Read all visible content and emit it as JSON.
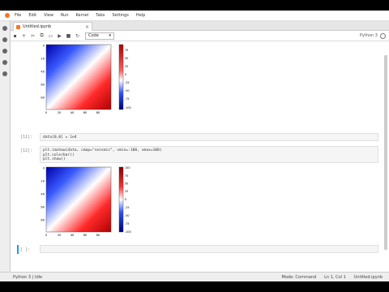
{
  "menu": [
    "File",
    "Edit",
    "View",
    "Run",
    "Kernel",
    "Tabs",
    "Settings",
    "Help"
  ],
  "tab": {
    "title": "Untitled.ipynb",
    "close": "×"
  },
  "toolbar": {
    "cell_type": "Code",
    "dropdown": "▾",
    "kernel": "Python 3"
  },
  "cells": [
    {
      "prompt": "[11]:",
      "lines": [
        "data[0,0] = 1e4"
      ]
    },
    {
      "prompt": "[12]:",
      "lines": [
        "plt.imshow(data, cmap=\"seismic\", vmin=-100, vmax=100)",
        "plt.colorbar()",
        "plt.show()"
      ]
    },
    {
      "prompt": "[ ]:",
      "lines": [
        ""
      ]
    }
  ],
  "plot1": {
    "y_ticks": [
      "0",
      "20",
      "40",
      "60",
      "80"
    ],
    "x_ticks": [
      "0",
      "20",
      "40",
      "60",
      "80"
    ],
    "cbar_ticks": [
      "75",
      "50",
      "25",
      "0",
      "-25",
      "-50",
      "-75",
      "-100"
    ]
  },
  "plot2": {
    "y_ticks": [
      "0",
      "20",
      "40",
      "60",
      "80"
    ],
    "x_ticks": [
      "0",
      "20",
      "40",
      "60",
      "80"
    ],
    "cbar_ticks": [
      "100",
      "75",
      "50",
      "25",
      "0",
      "-25",
      "-50",
      "-75",
      "-100"
    ]
  },
  "status": {
    "left": "Python 3 | Idle",
    "mode": "Mode: Command",
    "pos": "Ln 1, Col 1",
    "file": "Untitled.ipynb"
  }
}
